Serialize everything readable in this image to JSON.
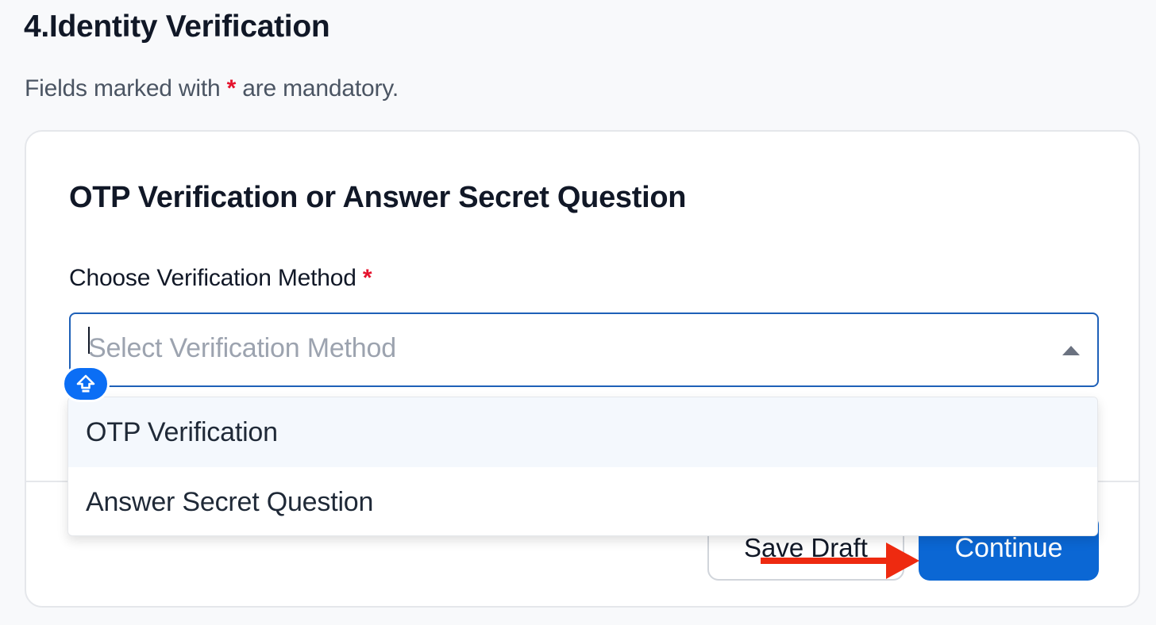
{
  "page": {
    "title": "4.Identity Verification",
    "mandatory_prefix": "Fields marked with",
    "mandatory_star": "*",
    "mandatory_suffix": "are mandatory."
  },
  "card": {
    "section_title": "OTP Verification or Answer Secret Question",
    "field": {
      "label": "Choose Verification Method",
      "required_star": "*",
      "placeholder": "Select Verification Method",
      "expanded": true
    },
    "dropdown": {
      "options": [
        {
          "label": "OTP Verification",
          "highlighted": true
        },
        {
          "label": "Answer Secret Question",
          "highlighted": false
        }
      ]
    },
    "actions": {
      "save_label": "Save Draft",
      "continue_label": "Continue"
    }
  },
  "icons": {
    "keyboard_badge": "shift-up-arrow-icon",
    "select_arrow": "caret-up-icon",
    "annotation": "red-arrow-pointer-icon"
  },
  "colors": {
    "primary": "#0b67d4",
    "required": "#e5132d",
    "focus_border": "#1e60b8",
    "annotation": "#ee2a10"
  }
}
